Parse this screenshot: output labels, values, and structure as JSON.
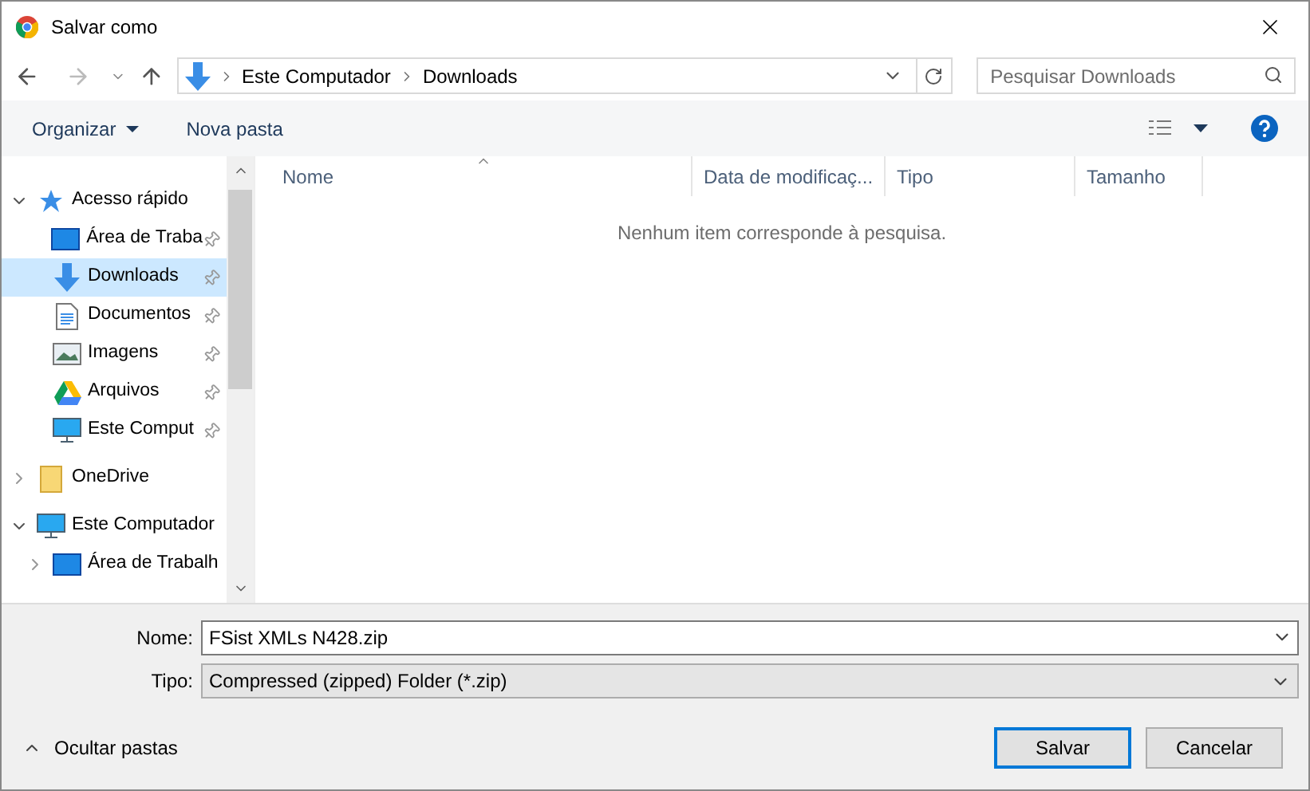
{
  "window": {
    "title": "Salvar como"
  },
  "address": {
    "path": [
      "Este Computador",
      "Downloads"
    ]
  },
  "search": {
    "placeholder": "Pesquisar Downloads"
  },
  "toolbar": {
    "organize": "Organizar",
    "new_folder": "Nova pasta"
  },
  "sidebar": {
    "items": [
      {
        "label": "Acesso rápido",
        "kind": "star",
        "expanded": true,
        "selected": false,
        "children": [
          {
            "label": "Área de Traba",
            "kind": "desktop",
            "pinned": true,
            "selected": false
          },
          {
            "label": "Downloads",
            "kind": "download",
            "pinned": true,
            "selected": true
          },
          {
            "label": "Documentos",
            "kind": "document",
            "pinned": true,
            "selected": false
          },
          {
            "label": "Imagens",
            "kind": "pictures",
            "pinned": true,
            "selected": false
          },
          {
            "label": "Arquivos",
            "kind": "drive",
            "pinned": true,
            "selected": false
          },
          {
            "label": "Este Comput",
            "kind": "computer",
            "pinned": true,
            "selected": false
          }
        ]
      },
      {
        "label": "OneDrive",
        "kind": "folder",
        "expanded": false,
        "selected": false
      },
      {
        "label": "Este Computador",
        "kind": "computer",
        "expanded": true,
        "selected": false,
        "children": [
          {
            "label": "Área de Trabalh",
            "kind": "desktop",
            "expanded": false,
            "pinned": false,
            "selected": false
          }
        ]
      }
    ]
  },
  "table": {
    "columns": [
      "Nome",
      "Data de modificaç...",
      "Tipo",
      "Tamanho"
    ],
    "empty_message": "Nenhum item corresponde à pesquisa."
  },
  "form": {
    "name_label": "Nome:",
    "name_value": "FSist XMLs N428.zip",
    "type_label": "Tipo:",
    "type_value": "Compressed (zipped) Folder (*.zip)"
  },
  "hide_folders": "Ocultar pastas",
  "buttons": [
    {
      "label": "Salvar",
      "primary": true
    },
    {
      "label": "Cancelar",
      "primary": false
    }
  ]
}
